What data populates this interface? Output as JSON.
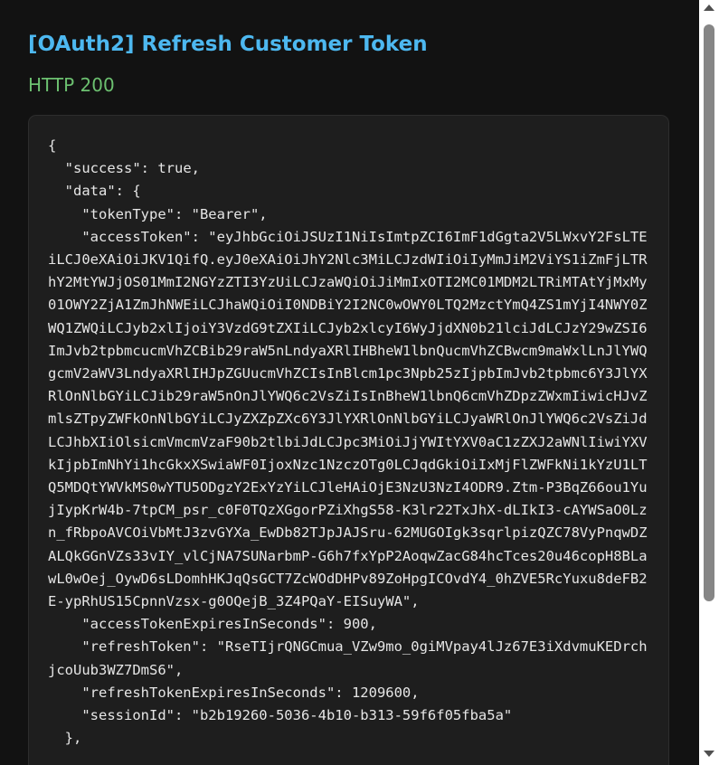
{
  "header": {
    "title": "[OAuth2] Refresh Customer Token",
    "status": "HTTP 200"
  },
  "response": {
    "body": "{\n  \"success\": true,\n  \"data\": {\n    \"tokenType\": \"Bearer\",\n    \"accessToken\": \"eyJhbGciOiJSUzI1NiIsImtpZCI6ImF1dGgta2V5LWxvY2FsLTEiLCJ0eXAiOiJKV1QifQ.eyJ0eXAiOiJhY2Nlc3MiLCJzdWIiOiIyMmJiM2ViYS1iZmFjLTRhY2MtYWJjOS01MmI2NGYzZTI3YzUiLCJzaWQiOiJiMmIxOTI2MC01MDM2LTRiMTAtYjMxMy01OWY2ZjA1ZmJhNWEiLCJhaWQiOiI0NDBiY2I2NC0wOWY0LTQ2MzctYmQ4ZS1mYjI4NWY0ZWQ1ZWQiLCJyb2xlIjoiY3VzdG9tZXIiLCJyb2xlcyI6WyJjdXN0b21lciJdLCJzY29wZSI6ImJvb2tpbmcucmVhZCBib29raW5nLndyaXRlIHBheW1lbnQucmVhZCBwcm9maWxlLnJlYWQgcmV2aWV3LndyaXRlIHJpZGUucmVhZCIsInBlcm1pc3Npb25zIjpbImJvb2tpbmc6Y3JlYXRlOnNlbGYiLCJib29raW5nOnJlYWQ6c2VsZiIsInBheW1lbnQ6cmVhZDpzZWxmIiwicHJvZmlsZTpyZWFkOnNlbGYiLCJyZXZpZXc6Y3JlYXRlOnNlbGYiLCJyaWRlOnJlYWQ6c2VsZiJdLCJhbXIiOlsicmVmcmVzaF90b2tlbiJdLCJpc3MiOiJjYWItYXV0aC1zZXJ2aWNlIiwiYXVkIjpbImNhYi1hcGkxXSwiaWF0IjoxNzc1NzczOTg0LCJqdGkiOiIxMjFlZWFkNi1kYzU1LTQ5MDQtYWVkMS0wYTU5ODgzY2ExYzYiLCJleHAiOjE3NzU3NzI4ODR9.Ztm-P3BqZ66ou1YujIypKrW4b-7tpCM_psr_c0F0TQzXGgorPZiXhgS58-K3lr22TxJhX-dLIkI3-cAYWSaO0Lzn_fRbpoAVCOiVbMtJ3zvGYXa_EwDb82TJpJAJSru-62MUGOIgk3sqrlpizQZC78VyPnqwDZALQkGGnVZs33vIY_vlCjNA7SUNarbmP-G6h7fxYpP2AoqwZacG84hcTces20u46copH8BLawL0wOej_OywD6sLDomhHKJqQsGCT7ZcWOdDHPv89ZoHpgICOvdY4_0hZVE5RcYuxu8deFB2E-ypRhUS15CpnnVzsx-g0OQejB_3Z4PQaY-EISuyWA\",\n    \"accessTokenExpiresInSeconds\": 900,\n    \"refreshToken\": \"RseTIjrQNGCmua_VZw9mo_0giMVpay4lJz67E3iXdvmuKEDrchjcoUub3WZ7DmS6\",\n    \"refreshTokenExpiresInSeconds\": 1209600,\n    \"sessionId\": \"b2b19260-5036-4b10-b313-59f6f05fba5a\"\n  },"
  },
  "icons": {
    "scroll_up": "scroll-up-arrow-icon",
    "scroll_down": "scroll-down-arrow-icon"
  },
  "colors": {
    "background": "#121212",
    "panel": "#1e1e1e",
    "title": "#4db8f0",
    "status_ok": "#6cc070",
    "text": "#e6e6e6"
  }
}
